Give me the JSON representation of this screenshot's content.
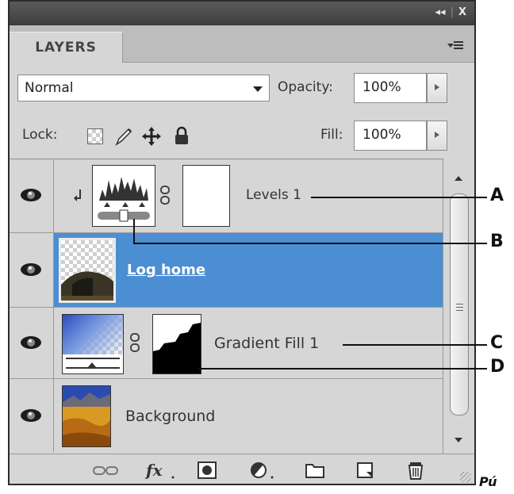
{
  "panel": {
    "title_controls": {
      "collapse": "◂◂",
      "close": "X"
    },
    "tab_label": "LAYERS"
  },
  "blend_mode": {
    "value": "Normal"
  },
  "opacity": {
    "label": "Opacity:",
    "value": "100%"
  },
  "lock": {
    "label": "Lock:"
  },
  "fill": {
    "label": "Fill:",
    "value": "100%"
  },
  "layers": [
    {
      "name": "Levels 1",
      "type": "adjustment",
      "visible": true,
      "selected": false
    },
    {
      "name": "Log home",
      "type": "pixel",
      "visible": true,
      "selected": true
    },
    {
      "name": "Gradient Fill 1",
      "type": "fill",
      "visible": true,
      "selected": false
    },
    {
      "name": "Background",
      "type": "pixel",
      "visible": true,
      "selected": false
    }
  ],
  "callouts": [
    "A",
    "B",
    "C",
    "D"
  ],
  "footnote": "Pú",
  "colors": {
    "selected_row": "#4c8ed2",
    "panel_bg": "#d6d6d6",
    "titlebar": "#3d3d3d"
  },
  "icons": {
    "footer": [
      "link-layers-icon",
      "fx-icon",
      "add-mask-icon",
      "adjustment-layer-icon",
      "new-group-icon",
      "new-layer-icon",
      "trash-icon"
    ],
    "lock": [
      "lock-transparent-icon",
      "lock-image-icon",
      "lock-position-icon",
      "lock-all-icon"
    ]
  }
}
